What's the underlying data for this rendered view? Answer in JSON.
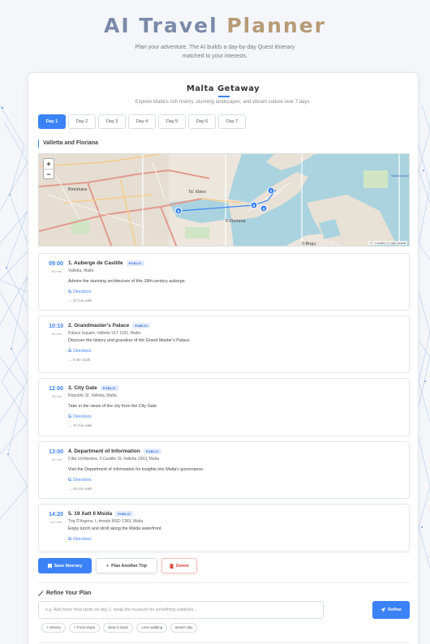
{
  "app": {
    "title_part1": "AI Travel ",
    "title_part2": "Planner",
    "subtitle": "Plan your adventure. The AI builds a day-by-day Quest itinerary matched to your interests."
  },
  "trip": {
    "title": "Malta Getaway",
    "description": "Explore Malta's rich history, stunning landscapes, and vibrant culture over 7 days."
  },
  "tabs": [
    {
      "label": "Day 1",
      "active": true
    },
    {
      "label": "Day 2",
      "active": false
    },
    {
      "label": "Day 3",
      "active": false
    },
    {
      "label": "Day 4",
      "active": false
    },
    {
      "label": "Day 5",
      "active": false
    },
    {
      "label": "Day 6",
      "active": false
    },
    {
      "label": "Day 7",
      "active": false
    }
  ],
  "day_section": {
    "label": "Valletta and Floriana"
  },
  "map": {
    "zoom_in": "+",
    "zoom_out": "−",
    "attribution": "🏳 Leaflet | © Ulpi Quest",
    "labels": {
      "birkirkara": "Birkirkara",
      "ta_xbiex": "Ta' Xbiex",
      "floriana": "Il-Floriana",
      "birgu": "Il-Birgu",
      "valletta": "Valletta Island",
      "marker_5": "5",
      "marker_3": "3",
      "marker_4": "4",
      "marker_2": "2"
    }
  },
  "stops": [
    {
      "time": "09:00",
      "duration": "60 min",
      "name": "1. Auberge de Castille",
      "badge": "PUBLIC",
      "address": "Valletta, Malta",
      "description": "Admire the stunning architecture of this 18th-century auberge.",
      "directions": "Directions",
      "walk": "→ 10 min walk"
    },
    {
      "time": "10:10",
      "duration": "90 min",
      "name": "2. Grandmaster's Palace",
      "badge": "PUBLIC",
      "address": "Palace Square, Valletta VLT 1191, Malta",
      "description": "Discover the history and grandeur of the Grand Master's Palace.",
      "directions": "Directions",
      "walk": "→ 5 min walk"
    },
    {
      "time": "12:00",
      "duration": "30 min",
      "name": "3. City Gate",
      "badge": "PUBLIC",
      "address": "Republic St, Valletta, Malta",
      "description": "Take in the views of the city from the City Gate.",
      "directions": "Directions",
      "walk": "→ 10 min walk"
    },
    {
      "time": "13:00",
      "duration": "40 min",
      "name": "4. Department of Information",
      "badge": "PUBLIC",
      "address": "Città Umilissima, 3 Castille St, Valletta 1063, Malta",
      "description": "Visit the Department of Information for insights into Malta's governance.",
      "directions": "Directions",
      "walk": "→ 15 min walk"
    },
    {
      "time": "14:20",
      "duration": "120 min",
      "name": "5. 19 Xatt Il Msida",
      "badge": "PUBLIC",
      "address": "Triq D'Argens, L-Imsida MSD 1369, Malta",
      "description": "Enjoy lunch and stroll along the Msida waterfront.",
      "directions": "Directions",
      "walk": ""
    }
  ],
  "actions": {
    "save": "Save Itinerary",
    "plan_another": "Plan Another Trip",
    "delete": "Delete"
  },
  "refine": {
    "title": "Refine Your Plan",
    "placeholder": "e.g. Add more food spots on day 2, swap the museum for something outdoors...",
    "button": "Refine",
    "chips": [
      "+ History",
      "+ Food stops",
      "Slow it down",
      "Less walking",
      "Beach day"
    ]
  },
  "colors": {
    "accent": "#3b82f6",
    "title_blue_gray": "#7a8aa8",
    "title_tan": "#b69b77",
    "danger": "#d9453d"
  },
  "icons": {
    "bookmark": "bookmark-icon",
    "plus": "plus-icon",
    "trash": "trash-icon",
    "wand": "magic-wand-icon",
    "send": "send-icon",
    "google": "google-g-icon",
    "arrow": "arrow-right-icon"
  }
}
